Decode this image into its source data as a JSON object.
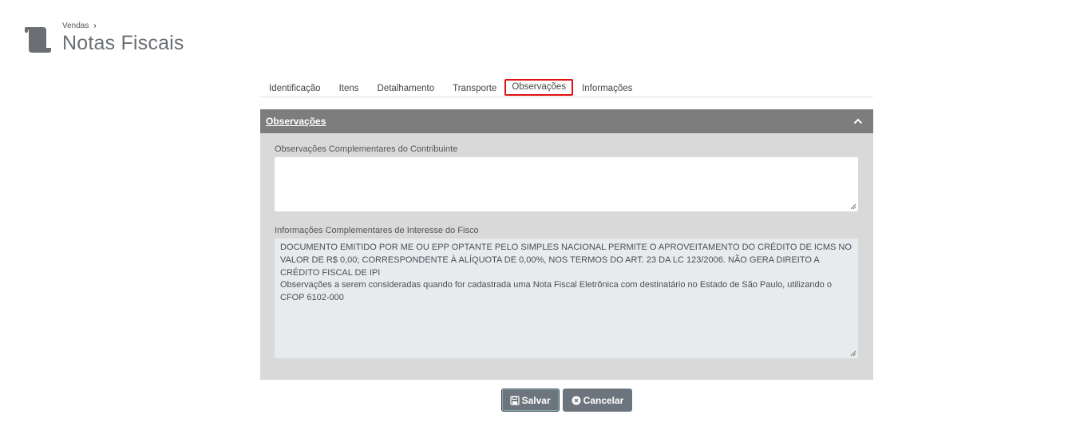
{
  "breadcrumb": {
    "parent": "Vendas"
  },
  "page": {
    "title": "Notas Fiscais"
  },
  "tabs": [
    {
      "label": "Identificação"
    },
    {
      "label": "Itens"
    },
    {
      "label": "Detalhamento"
    },
    {
      "label": "Transporte"
    },
    {
      "label": "Observações",
      "active": true
    },
    {
      "label": "Informações"
    }
  ],
  "panel": {
    "title": "Observações",
    "fields": [
      {
        "label": "Observações Complementares do Contribuinte",
        "value": ""
      },
      {
        "label": "Informações Complementares de Interesse do Fisco",
        "value": "DOCUMENTO EMITIDO POR ME OU EPP OPTANTE PELO SIMPLES NACIONAL PERMITE O APROVEITAMENTO DO CRÉDITO DE ICMS NO VALOR DE R$ 0,00; CORRESPONDENTE À ALÍQUOTA DE 0,00%, NOS TERMOS DO ART. 23 DA LC 123/2006. NÃO GERA DIREITO A CRÉDITO FISCAL DE IPI\nObservações a serem consideradas quando for cadastrada uma Nota Fiscal Eletrônica com destinatário no Estado de São Paulo, utilizando o CFOP 6102-000"
      }
    ]
  },
  "actions": {
    "save_label": "Salvar",
    "cancel_label": "Cancelar"
  },
  "colors": {
    "accent_tab_border": "#e01010",
    "panel_header": "#7d7d7d",
    "button": "#6c757d"
  },
  "icons": {
    "header": "scroll-document-icon",
    "collapse": "chevron-up-icon",
    "save": "floppy-disk-icon",
    "cancel": "close-circle-icon"
  }
}
